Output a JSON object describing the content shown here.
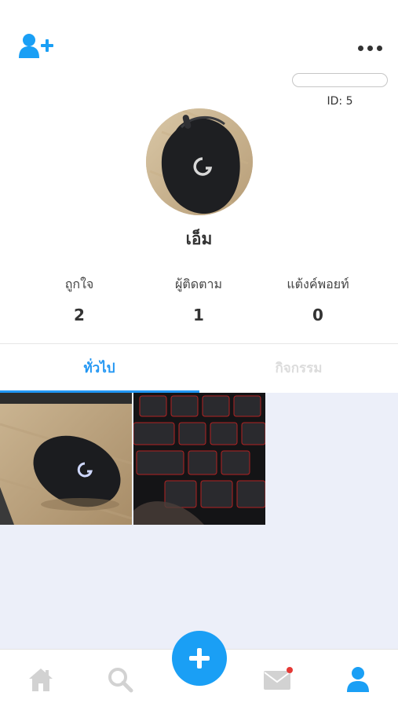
{
  "profile": {
    "id_label": "ID: 5",
    "name": "เอ็ม"
  },
  "stats": [
    {
      "label": "ถูกใจ",
      "value": "2"
    },
    {
      "label": "ผู้ติดตาม",
      "value": "1"
    },
    {
      "label": "แต้งค์พอยท์",
      "value": "0"
    }
  ],
  "tabs": {
    "general": "ทั่วไป",
    "activity": "กิจกรรม"
  },
  "colors": {
    "accent": "#2196f3",
    "fab": "#1a9ff5",
    "grid_background": "#eceff9",
    "notification_dot": "#e53935"
  },
  "icons": {
    "top_left": "add-user-icon",
    "top_right": "more-options-icon",
    "nav": [
      "home-icon",
      "search-icon",
      "add-icon",
      "mail-icon",
      "profile-icon"
    ]
  }
}
